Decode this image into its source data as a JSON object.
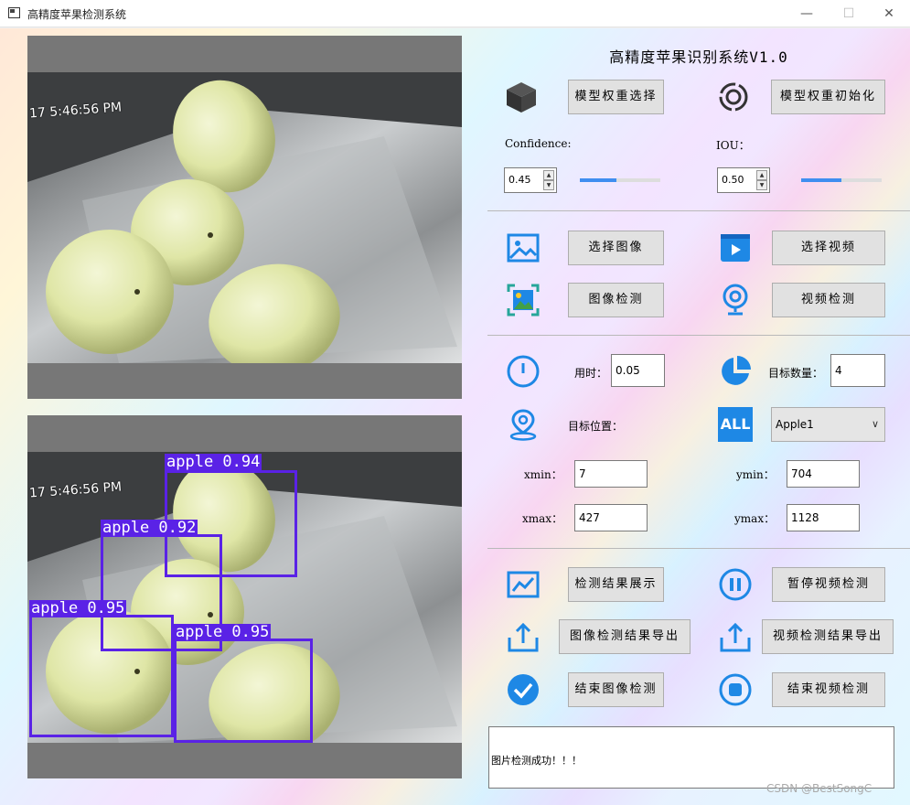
{
  "window": {
    "title": "高精度苹果检测系统",
    "minimize": "—",
    "maximize": "☐",
    "close": "✕"
  },
  "image_panels": {
    "timestamp": "17 5:46:56 PM",
    "detections": [
      {
        "label": "apple 0.94"
      },
      {
        "label": "apple 0.92"
      },
      {
        "label": "apple 0.95"
      },
      {
        "label": "apple 0.95"
      }
    ]
  },
  "controls": {
    "system_title": "高精度苹果识别系统V1.0",
    "model_weight_select": "模型权重选择",
    "model_weight_init": "模型权重初始化",
    "confidence_label": "Confidence:",
    "confidence_value": "0.45",
    "confidence_fraction": 0.45,
    "iou_label": "IOU：",
    "iou_value": "0.50",
    "iou_fraction": 0.5,
    "select_image": "选择图像",
    "select_video": "选择视频",
    "image_detect": "图像检测",
    "video_detect": "视频检测",
    "time_label": "用时：",
    "time_value": "0.05",
    "target_count_label": "目标数量：",
    "target_count_value": "4",
    "target_position_label": "目标位置：",
    "all_icon_text": "ALL",
    "target_select_value": "Apple1",
    "xmin_label": "xmin：",
    "xmin_value": "7",
    "ymin_label": "ymin：",
    "ymin_value": "704",
    "xmax_label": "xmax：",
    "xmax_value": "427",
    "ymax_label": "ymax：",
    "ymax_value": "1128",
    "show_results": "检测结果展示",
    "pause_video": "暂停视频检测",
    "export_image_results": "图像检测结果导出",
    "export_video_results": "视频检测结果导出",
    "end_image_detect": "结束图像检测",
    "end_video_detect": "结束视频检测",
    "log_text": "图片检测成功！！！"
  },
  "watermark": "CSDN @BestSongC",
  "colors": {
    "accent": "#1e88e5",
    "bbox": "#5a22e6"
  }
}
